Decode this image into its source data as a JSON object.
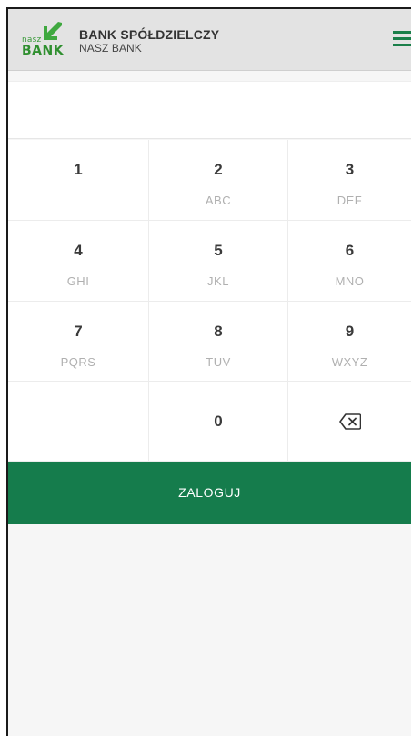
{
  "header": {
    "logo": {
      "top_text": "nasz",
      "bottom_text": "BANK"
    },
    "title": "BANK SPÓŁDZIELCZY",
    "subtitle": "NASZ BANK",
    "menu_icon": "hamburger-menu-icon"
  },
  "pin": {
    "value": ""
  },
  "keypad": {
    "keys": [
      {
        "digit": "1",
        "letters": ""
      },
      {
        "digit": "2",
        "letters": "ABC"
      },
      {
        "digit": "3",
        "letters": "DEF"
      },
      {
        "digit": "4",
        "letters": "GHI"
      },
      {
        "digit": "5",
        "letters": "JKL"
      },
      {
        "digit": "6",
        "letters": "MNO"
      },
      {
        "digit": "7",
        "letters": "PQRS"
      },
      {
        "digit": "8",
        "letters": "TUV"
      },
      {
        "digit": "9",
        "letters": "WXYZ"
      },
      {
        "digit": "0",
        "letters": ""
      }
    ],
    "backspace_icon": "backspace-icon"
  },
  "login": {
    "label": "ZALOGUJ"
  },
  "colors": {
    "brand_green": "#157c4c",
    "logo_green": "#2f8f2f",
    "header_bg": "#e3e3e3"
  }
}
